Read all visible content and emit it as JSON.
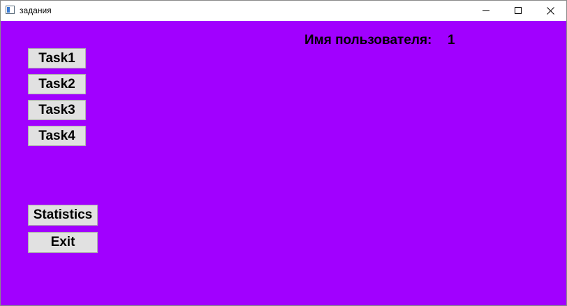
{
  "window": {
    "title": "задания"
  },
  "colors": {
    "background": "#a100ff",
    "button_face": "#e1e1e1"
  },
  "icons": {
    "app": "app-window-icon",
    "minimize": "minimize-icon",
    "maximize": "maximize-icon",
    "close": "close-icon"
  },
  "buttons": {
    "task1": "Task1",
    "task2": "Task2",
    "task3": "Task3",
    "task4": "Task4",
    "statistics": "Statistics",
    "exit": "Exit"
  },
  "user": {
    "label": "Имя пользователя:",
    "value": "1"
  }
}
